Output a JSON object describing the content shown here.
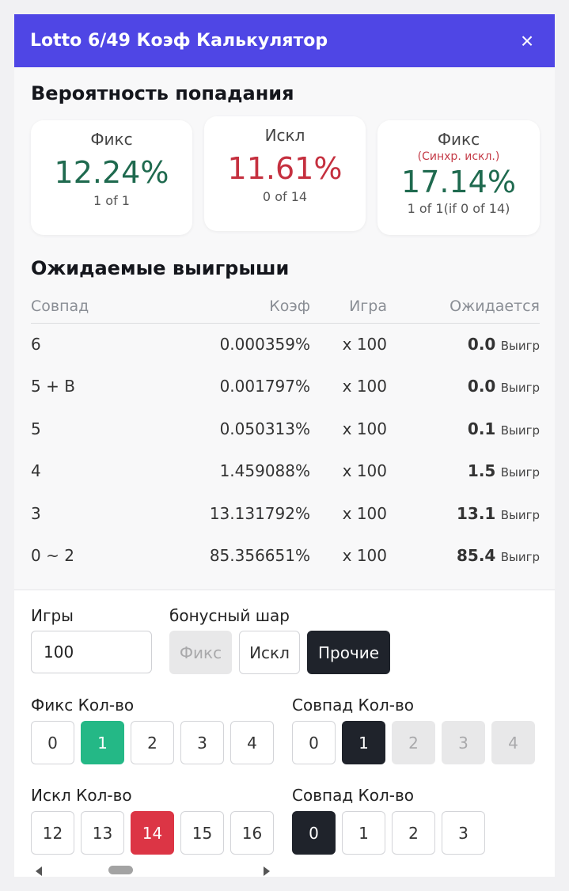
{
  "header": {
    "title": "Lotto 6/49 Коэф Калькулятор",
    "close_icon": "×"
  },
  "probability": {
    "title": "Вероятность попадания",
    "cards": [
      {
        "label": "Фикс",
        "sub": "",
        "value": "12.24%",
        "note": "1 of 1",
        "color": "#1f6a4f"
      },
      {
        "label": "Искл",
        "sub": "",
        "value": "11.61%",
        "note": "0 of 14",
        "color": "#c5303f"
      },
      {
        "label": "Фикс",
        "sub": "(Синхр. искл.)",
        "value": "17.14%",
        "note": "1 of 1(if 0 of 14)",
        "color": "#1f6a4f"
      }
    ]
  },
  "expected": {
    "title": "Ожидаемые выигрыши",
    "headers": [
      "Совпад",
      "Коэф",
      "Игра",
      "Ожидается"
    ],
    "unit": "Выигр",
    "rows": [
      {
        "match": "6",
        "odds": "0.000359%",
        "games": "x 100",
        "expected": "0.0"
      },
      {
        "match": "5 + B",
        "odds": "0.001797%",
        "games": "x 100",
        "expected": "0.0"
      },
      {
        "match": "5",
        "odds": "0.050313%",
        "games": "x 100",
        "expected": "0.1"
      },
      {
        "match": "4",
        "odds": "1.459088%",
        "games": "x 100",
        "expected": "1.5"
      },
      {
        "match": "3",
        "odds": "13.131792%",
        "games": "x 100",
        "expected": "13.1"
      },
      {
        "match": "0 ~ 2",
        "odds": "85.356651%",
        "games": "x 100",
        "expected": "85.4"
      }
    ]
  },
  "controls": {
    "games_label": "Игры",
    "games_value": "100",
    "bonus_label": "бонусный шар",
    "bonus_options": [
      "Фикс",
      "Искл",
      "Прочие"
    ],
    "bonus_selected": "Прочие",
    "fix_count_label": "Фикс Кол-во",
    "fix_count_options": [
      "0",
      "1",
      "2",
      "3",
      "4"
    ],
    "fix_count_selected": "1",
    "fix_match_label": "Совпад Кол-во",
    "fix_match_options": [
      "0",
      "1",
      "2",
      "3",
      "4"
    ],
    "fix_match_selected": "1",
    "excl_count_label": "Искл Кол-во",
    "excl_count_options": [
      "12",
      "13",
      "14",
      "15",
      "16"
    ],
    "excl_count_selected": "14",
    "excl_match_label": "Совпад Кол-во",
    "excl_match_options": [
      "0",
      "1",
      "2",
      "3"
    ],
    "excl_match_selected": "0"
  },
  "colors": {
    "accent": "#4f46e5",
    "green": "#24b886",
    "red": "#dc3545",
    "dark": "#1f232b"
  }
}
